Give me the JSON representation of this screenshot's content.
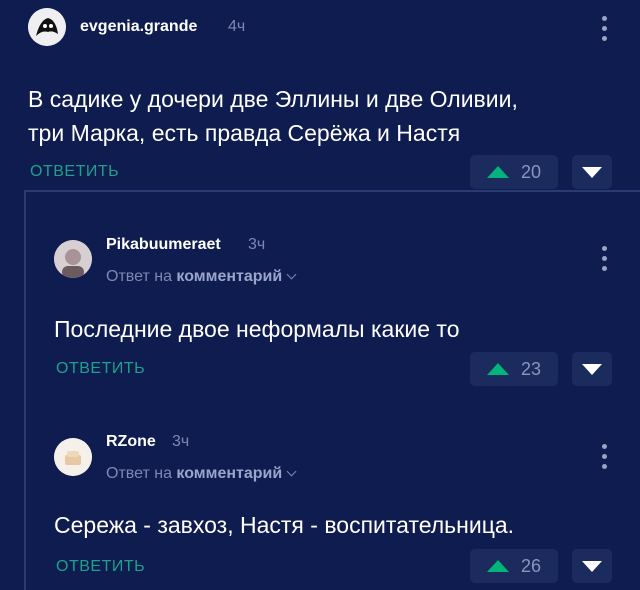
{
  "comments": [
    {
      "username": "evgenia.grande",
      "time": "4ч",
      "text_lines": [
        "В садике у дочери две Эллины и две Оливии,",
        "три Марка, есть правда Серёжа и Настя"
      ],
      "reply_label": "ОТВЕТИТЬ",
      "votes": "20"
    },
    {
      "username": "Pikabuumeraet",
      "time": "3ч",
      "reply_to_prefix": "Ответ на",
      "reply_to_link": "комментарий",
      "text_lines": [
        "Последние двое неформалы какие то"
      ],
      "reply_label": "ОТВЕТИТЬ",
      "votes": "23"
    },
    {
      "username": "RZone",
      "time": "3ч",
      "reply_to_prefix": "Ответ на",
      "reply_to_link": "комментарий",
      "text_lines": [
        "Сережа - завхоз, Настя - воспитательница."
      ],
      "reply_label": "ОТВЕТИТЬ",
      "votes": "26"
    }
  ],
  "colors": {
    "background": "#0f1c4f",
    "accent_reply": "#1fa08a",
    "upvote": "#00b47a"
  },
  "icons": [
    "avatar",
    "kebab-menu-icon",
    "upvote-arrow-icon",
    "downvote-arrow-icon",
    "chevron-down-icon"
  ]
}
